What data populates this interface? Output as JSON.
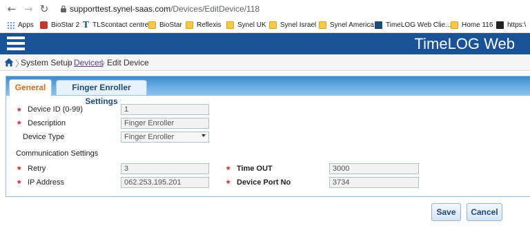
{
  "browser": {
    "url_host": "supporttest.synel-saas.com",
    "url_path": "/Devices/EditDevice/118",
    "bookmarks": [
      {
        "label": "Apps",
        "icon": "apps-grid-icon"
      },
      {
        "label": "BioStar 2",
        "icon": "biostar-icon"
      },
      {
        "label": "TLScontact centre",
        "icon": "tlscontact-icon"
      },
      {
        "label": "BioStar",
        "icon": "folder-icon"
      },
      {
        "label": "Reflexis",
        "icon": "folder-icon"
      },
      {
        "label": "Synel UK",
        "icon": "folder-icon"
      },
      {
        "label": "Synel Israel",
        "icon": "folder-icon"
      },
      {
        "label": "Synel America",
        "icon": "folder-icon"
      },
      {
        "label": "TimeLOG Web Clie...",
        "icon": "timelog-icon"
      },
      {
        "label": "Home 116",
        "icon": "folder-icon"
      },
      {
        "label": "https:\\",
        "icon": "site-icon"
      }
    ]
  },
  "header": {
    "title": "TimeLOG Web"
  },
  "breadcrumb": {
    "items": [
      "System Setup",
      "Devices",
      "Edit Device"
    ]
  },
  "tabs": [
    {
      "label": "General",
      "active": true
    },
    {
      "label": "Finger Enroller Settings",
      "active": false
    }
  ],
  "form": {
    "required_mark": "*",
    "device_id": {
      "label": "Device ID (0-99)",
      "value": "1"
    },
    "description": {
      "label": "Description",
      "value": "Finger Enroller"
    },
    "device_type": {
      "label": "Device Type",
      "value": "Finger Enroller"
    },
    "communication_section": "Communication Settings",
    "retry": {
      "label": "Retry",
      "value": "3"
    },
    "time_out": {
      "label": "Time OUT",
      "value": "3000"
    },
    "ip_address": {
      "label": "IP Address",
      "value": "062.253.195.201"
    },
    "device_port": {
      "label": "Device Port No",
      "value": "3734"
    }
  },
  "actions": {
    "save_label": "Save",
    "cancel_label": "Cancel"
  },
  "colors": {
    "header_bg": "#1a5297",
    "active_tab_text": "#e06a1a",
    "required": "#e02020"
  }
}
